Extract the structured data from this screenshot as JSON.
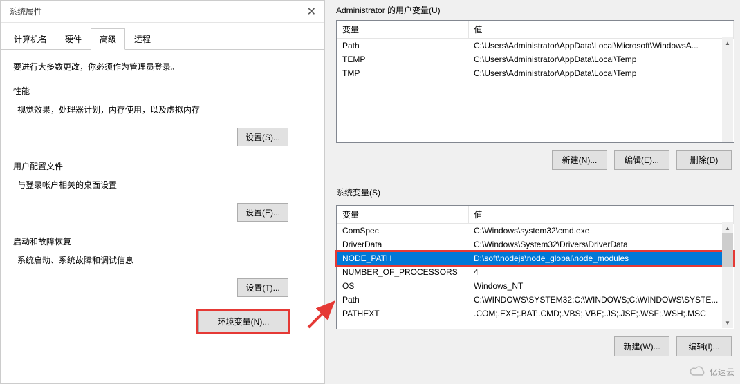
{
  "system_properties": {
    "title": "系统属性",
    "tabs": [
      {
        "label": "计算机名"
      },
      {
        "label": "硬件"
      },
      {
        "label": "高级",
        "active": true
      },
      {
        "label": "远程"
      }
    ],
    "admin_note": "要进行大多数更改，你必须作为管理员登录。",
    "sections": {
      "performance": {
        "title": "性能",
        "desc": "视觉效果，处理器计划，内存使用，以及虚拟内存",
        "button": "设置(S)..."
      },
      "user_profile": {
        "title": "用户配置文件",
        "desc": "与登录帐户相关的桌面设置",
        "button": "设置(E)..."
      },
      "startup": {
        "title": "启动和故障恢复",
        "desc": "系统启动、系统故障和调试信息",
        "button": "设置(T)..."
      }
    },
    "env_button": "环境变量(N)..."
  },
  "env_dialog": {
    "user_section_label": "Administrator 的用户变量(U)",
    "sys_section_label": "系统变量(S)",
    "header_name": "变量",
    "header_value": "值",
    "user_vars": [
      {
        "name": "Path",
        "value": "C:\\Users\\Administrator\\AppData\\Local\\Microsoft\\WindowsA..."
      },
      {
        "name": "TEMP",
        "value": "C:\\Users\\Administrator\\AppData\\Local\\Temp"
      },
      {
        "name": "TMP",
        "value": "C:\\Users\\Administrator\\AppData\\Local\\Temp"
      }
    ],
    "sys_vars": [
      {
        "name": "ComSpec",
        "value": "C:\\Windows\\system32\\cmd.exe"
      },
      {
        "name": "DriverData",
        "value": "C:\\Windows\\System32\\Drivers\\DriverData"
      },
      {
        "name": "NODE_PATH",
        "value": "D:\\soft\\nodejs\\node_global\\node_modules",
        "selected": true,
        "highlighted": true
      },
      {
        "name": "NUMBER_OF_PROCESSORS",
        "value": "4"
      },
      {
        "name": "OS",
        "value": "Windows_NT"
      },
      {
        "name": "Path",
        "value": "C:\\WINDOWS\\SYSTEM32;C:\\WINDOWS;C:\\WINDOWS\\SYSTE..."
      },
      {
        "name": "PATHEXT",
        "value": ".COM;.EXE;.BAT;.CMD;.VBS;.VBE;.JS;.JSE;.WSF;.WSH;.MSC"
      }
    ],
    "buttons": {
      "new": "新建(N)...",
      "edit": "编辑(E)...",
      "delete": "删除(D)",
      "new2": "新建(W)...",
      "edit2": "编辑(I)..."
    }
  },
  "watermark_text": "亿速云"
}
